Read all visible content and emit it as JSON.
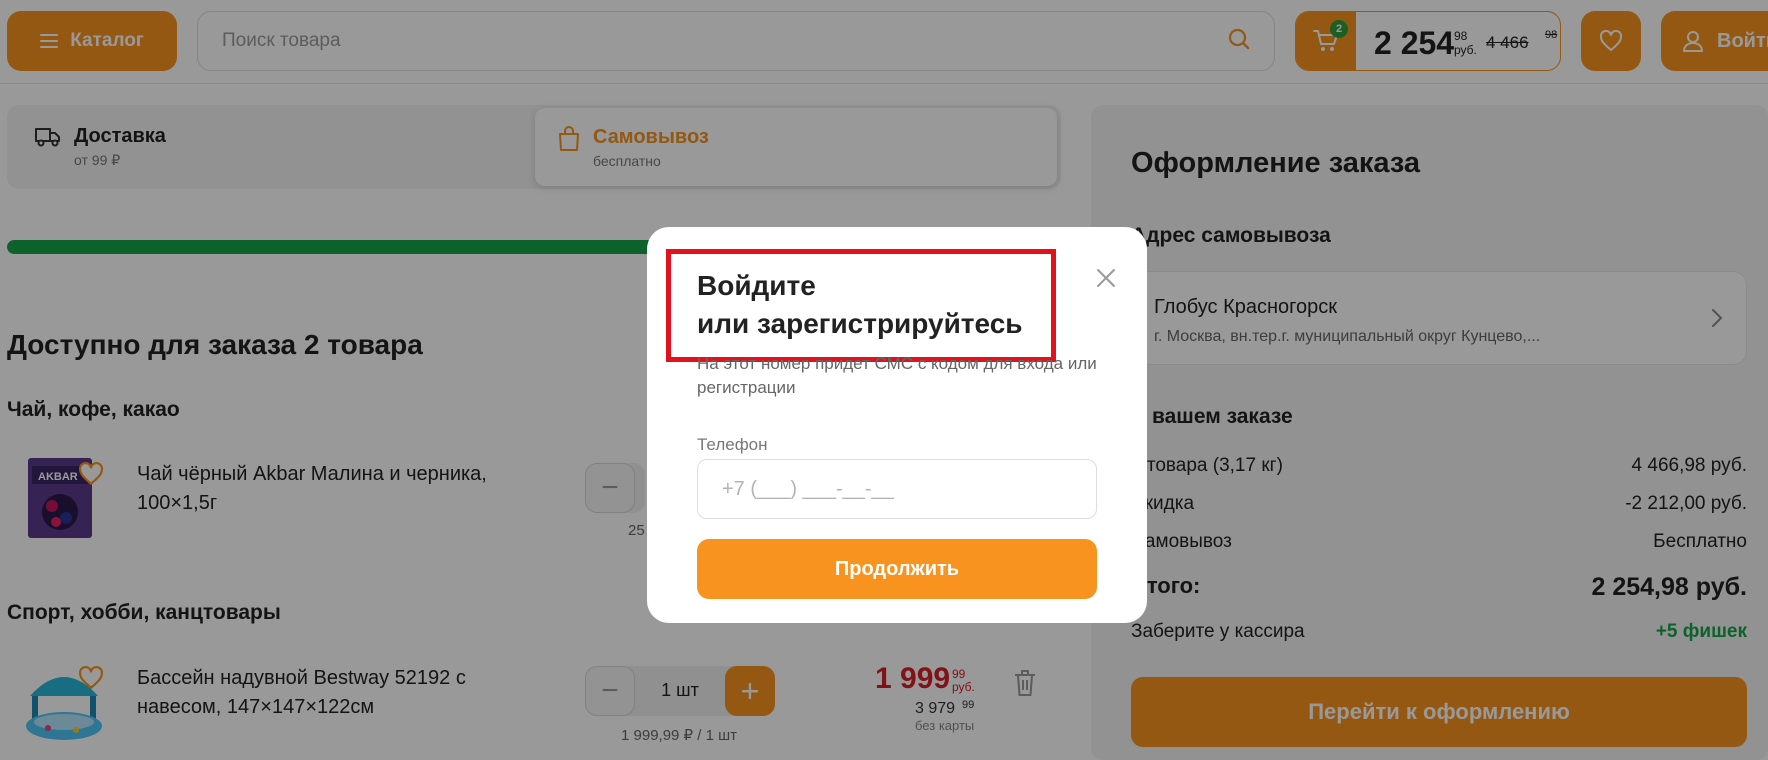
{
  "header": {
    "catalog_label": "Каталог",
    "search_placeholder": "Поиск товара",
    "cart": {
      "badge": "2",
      "price": "2 254",
      "price_kop": "98",
      "price_unit": "руб.",
      "old_price": "4 466",
      "old_price_kop": "98"
    },
    "login_label": "Войти"
  },
  "delivery_tabs": [
    {
      "title": "Доставка",
      "subtitle": "от 99 ₽"
    },
    {
      "title": "Самовывоз",
      "subtitle": "бесплатно"
    }
  ],
  "progress_fraction": 0.71,
  "available_title": "Доступно для заказа 2 товара",
  "categories": [
    {
      "title": "Чай, кофе, какао",
      "product": {
        "name": "Чай чёрный Akbar Малина и черника, 100×1,5г",
        "unit_price": "25"
      }
    },
    {
      "title": "Спорт, хобби, канцтовары",
      "product": {
        "name": "Бассейн надувной Bestway 52192 с навесом, 147×147×122см",
        "qty": "1 шт",
        "unit_price": "1 999,99 ₽ / 1 шт",
        "price": "1 999",
        "price_kop": "99",
        "price_unit": "руб.",
        "old_price": "3 979",
        "old_price_kop": "99",
        "note": "без карты"
      }
    }
  ],
  "order": {
    "title": "Оформление заказа",
    "pickup_title": "Адрес самовывоза",
    "store_name": "Глобус Красногорск",
    "store_address": "г. Москва, вн.тер.г. муниципальный округ Кунцево,...",
    "summary_title": "В вашем заказе",
    "rows": [
      {
        "label": "2 товара (3,17 кг)",
        "value": "4 466,98 руб."
      },
      {
        "label": "Скидка",
        "value": "-2 212,00 руб."
      },
      {
        "label": "Самовывоз",
        "value": "Бесплатно"
      }
    ],
    "total_label": "Итого:",
    "total_value": "2 254,98 руб.",
    "bonus_label": "Заберите у кассира",
    "bonus_value": "+5 фишек",
    "checkout_label": "Перейти к оформлению"
  },
  "modal": {
    "title": "Войдите\nили зарегистрируйтесь",
    "description": "На этот номер придет СМС с кодом для входа или регистрации",
    "phone_label": "Телефон",
    "phone_placeholder": "+7 (___) ___-__-__",
    "continue_label": "Продолжить"
  },
  "colors": {
    "accent": "#f7931e",
    "progress": "#17a34a",
    "sale": "#d62027",
    "highlight": "#e3111b"
  }
}
